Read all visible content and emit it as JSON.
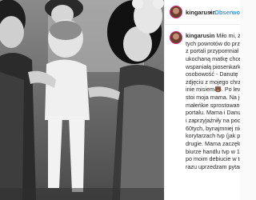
{
  "post": {
    "username": "kingarusin",
    "separator": "•",
    "follow_label": "Obserwo",
    "caption_first": "Miło mi, że",
    "caption_lines": [
      "tych powrotów do przes",
      "z portali przypomniał mo",
      "ukochaną matkę chcesz",
      "wspaniałą piosenkarkę i",
      "osobowość - Danutę Rin",
      "zdjęciu z mojego chrztu",
      "inie misiem🐻. Po lewej",
      "stoi moja mama. Na jej p",
      "małeńkie sprostowanie",
      "portalu. Mama i Danusia",
      "i zaprzyjaźniły na począt",
      "60tych, bynajmniej nie n",
      "korytarzach tvp (jak piszą",
      "drugie. Mama zaczęła pr",
      "biurze handlu tvp w 199",
      "po moim debiucie w telev",
      "razu uprzedzam pytania"
    ]
  }
}
